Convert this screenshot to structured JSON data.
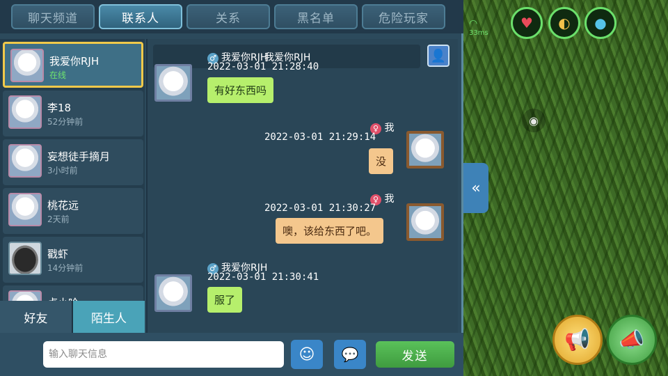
{
  "tabs": [
    {
      "label": "聊天频道"
    },
    {
      "label": "联系人",
      "active": true
    },
    {
      "label": "关系"
    },
    {
      "label": "黑名单"
    },
    {
      "label": "危险玩家"
    }
  ],
  "contacts": [
    {
      "name": "我爱你RJH",
      "status": "在线",
      "online": true,
      "selected": true
    },
    {
      "name": "李18",
      "status": "52分钟前"
    },
    {
      "name": "妄想徒手摘月",
      "status": "3小时前"
    },
    {
      "name": "桃花远",
      "status": "2天前"
    },
    {
      "name": "戳虾",
      "status": "14分钟前"
    },
    {
      "name": "卢小哈",
      "status": ""
    }
  ],
  "categories": [
    {
      "label": "好友"
    },
    {
      "label": "陌生人",
      "active": true
    }
  ],
  "conversation": {
    "partner_title": "我爱你RJH",
    "messages": [
      {
        "sender": "我爱你RJH",
        "gender": "male",
        "time": "2022-03-01  21:28:40",
        "text": "有好东西吗",
        "mine": false
      },
      {
        "sender": "我",
        "gender": "female",
        "time": "2022-03-01  21:29:14",
        "text": "没",
        "mine": true
      },
      {
        "sender": "我",
        "gender": "female",
        "time": "2022-03-01  21:30:27",
        "text": "噢，该给东西了吧。",
        "mine": true
      },
      {
        "sender": "我爱你RJH",
        "gender": "male",
        "time": "2022-03-01  21:30:41",
        "text": "服了",
        "mine": false
      }
    ]
  },
  "input": {
    "placeholder": "输入聊天信息",
    "value": ""
  },
  "send_label": "发送",
  "hud": {
    "ping": "33ms"
  },
  "colors": {
    "accent": "#4aa3b8",
    "bubble_in": "#b6ef6c",
    "bubble_out": "#f4c78d",
    "online": "#6fe36f",
    "selected_border": "#f1c94a"
  }
}
